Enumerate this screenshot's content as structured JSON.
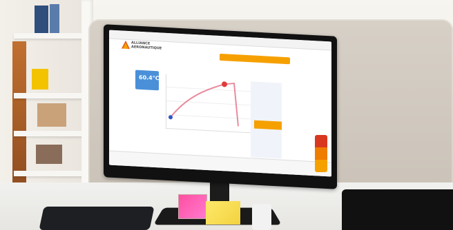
{
  "scene": {
    "description_colors": {
      "accent_orange": "#f6a000",
      "accent_red": "#d8381f",
      "monitor_black": "#111111",
      "partition_beige": "#d7d0c7"
    }
  },
  "screen": {
    "logo_text": "ALLIANCE",
    "logo_subtext": "AERONAUTIQUE",
    "heading": "",
    "temperature": "60.4°C"
  }
}
